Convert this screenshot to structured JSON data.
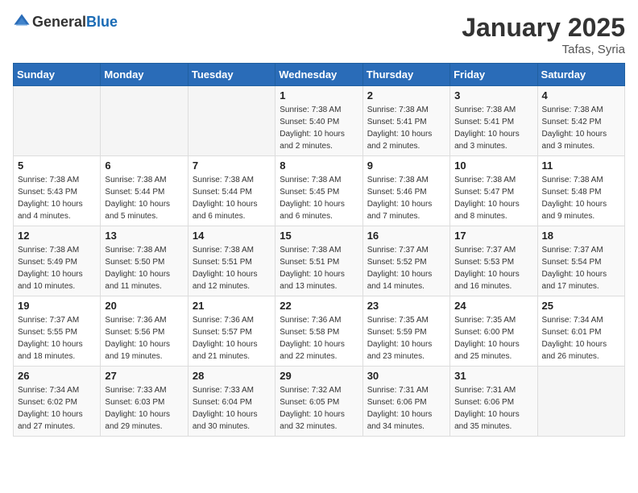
{
  "logo": {
    "general": "General",
    "blue": "Blue"
  },
  "header": {
    "title": "January 2025",
    "subtitle": "Tafas, Syria"
  },
  "weekdays": [
    "Sunday",
    "Monday",
    "Tuesday",
    "Wednesday",
    "Thursday",
    "Friday",
    "Saturday"
  ],
  "weeks": [
    [
      {
        "day": "",
        "sunrise": "",
        "sunset": "",
        "daylight": ""
      },
      {
        "day": "",
        "sunrise": "",
        "sunset": "",
        "daylight": ""
      },
      {
        "day": "",
        "sunrise": "",
        "sunset": "",
        "daylight": ""
      },
      {
        "day": "1",
        "sunrise": "Sunrise: 7:38 AM",
        "sunset": "Sunset: 5:40 PM",
        "daylight": "Daylight: 10 hours and 2 minutes."
      },
      {
        "day": "2",
        "sunrise": "Sunrise: 7:38 AM",
        "sunset": "Sunset: 5:41 PM",
        "daylight": "Daylight: 10 hours and 2 minutes."
      },
      {
        "day": "3",
        "sunrise": "Sunrise: 7:38 AM",
        "sunset": "Sunset: 5:41 PM",
        "daylight": "Daylight: 10 hours and 3 minutes."
      },
      {
        "day": "4",
        "sunrise": "Sunrise: 7:38 AM",
        "sunset": "Sunset: 5:42 PM",
        "daylight": "Daylight: 10 hours and 3 minutes."
      }
    ],
    [
      {
        "day": "5",
        "sunrise": "Sunrise: 7:38 AM",
        "sunset": "Sunset: 5:43 PM",
        "daylight": "Daylight: 10 hours and 4 minutes."
      },
      {
        "day": "6",
        "sunrise": "Sunrise: 7:38 AM",
        "sunset": "Sunset: 5:44 PM",
        "daylight": "Daylight: 10 hours and 5 minutes."
      },
      {
        "day": "7",
        "sunrise": "Sunrise: 7:38 AM",
        "sunset": "Sunset: 5:44 PM",
        "daylight": "Daylight: 10 hours and 6 minutes."
      },
      {
        "day": "8",
        "sunrise": "Sunrise: 7:38 AM",
        "sunset": "Sunset: 5:45 PM",
        "daylight": "Daylight: 10 hours and 6 minutes."
      },
      {
        "day": "9",
        "sunrise": "Sunrise: 7:38 AM",
        "sunset": "Sunset: 5:46 PM",
        "daylight": "Daylight: 10 hours and 7 minutes."
      },
      {
        "day": "10",
        "sunrise": "Sunrise: 7:38 AM",
        "sunset": "Sunset: 5:47 PM",
        "daylight": "Daylight: 10 hours and 8 minutes."
      },
      {
        "day": "11",
        "sunrise": "Sunrise: 7:38 AM",
        "sunset": "Sunset: 5:48 PM",
        "daylight": "Daylight: 10 hours and 9 minutes."
      }
    ],
    [
      {
        "day": "12",
        "sunrise": "Sunrise: 7:38 AM",
        "sunset": "Sunset: 5:49 PM",
        "daylight": "Daylight: 10 hours and 10 minutes."
      },
      {
        "day": "13",
        "sunrise": "Sunrise: 7:38 AM",
        "sunset": "Sunset: 5:50 PM",
        "daylight": "Daylight: 10 hours and 11 minutes."
      },
      {
        "day": "14",
        "sunrise": "Sunrise: 7:38 AM",
        "sunset": "Sunset: 5:51 PM",
        "daylight": "Daylight: 10 hours and 12 minutes."
      },
      {
        "day": "15",
        "sunrise": "Sunrise: 7:38 AM",
        "sunset": "Sunset: 5:51 PM",
        "daylight": "Daylight: 10 hours and 13 minutes."
      },
      {
        "day": "16",
        "sunrise": "Sunrise: 7:37 AM",
        "sunset": "Sunset: 5:52 PM",
        "daylight": "Daylight: 10 hours and 14 minutes."
      },
      {
        "day": "17",
        "sunrise": "Sunrise: 7:37 AM",
        "sunset": "Sunset: 5:53 PM",
        "daylight": "Daylight: 10 hours and 16 minutes."
      },
      {
        "day": "18",
        "sunrise": "Sunrise: 7:37 AM",
        "sunset": "Sunset: 5:54 PM",
        "daylight": "Daylight: 10 hours and 17 minutes."
      }
    ],
    [
      {
        "day": "19",
        "sunrise": "Sunrise: 7:37 AM",
        "sunset": "Sunset: 5:55 PM",
        "daylight": "Daylight: 10 hours and 18 minutes."
      },
      {
        "day": "20",
        "sunrise": "Sunrise: 7:36 AM",
        "sunset": "Sunset: 5:56 PM",
        "daylight": "Daylight: 10 hours and 19 minutes."
      },
      {
        "day": "21",
        "sunrise": "Sunrise: 7:36 AM",
        "sunset": "Sunset: 5:57 PM",
        "daylight": "Daylight: 10 hours and 21 minutes."
      },
      {
        "day": "22",
        "sunrise": "Sunrise: 7:36 AM",
        "sunset": "Sunset: 5:58 PM",
        "daylight": "Daylight: 10 hours and 22 minutes."
      },
      {
        "day": "23",
        "sunrise": "Sunrise: 7:35 AM",
        "sunset": "Sunset: 5:59 PM",
        "daylight": "Daylight: 10 hours and 23 minutes."
      },
      {
        "day": "24",
        "sunrise": "Sunrise: 7:35 AM",
        "sunset": "Sunset: 6:00 PM",
        "daylight": "Daylight: 10 hours and 25 minutes."
      },
      {
        "day": "25",
        "sunrise": "Sunrise: 7:34 AM",
        "sunset": "Sunset: 6:01 PM",
        "daylight": "Daylight: 10 hours and 26 minutes."
      }
    ],
    [
      {
        "day": "26",
        "sunrise": "Sunrise: 7:34 AM",
        "sunset": "Sunset: 6:02 PM",
        "daylight": "Daylight: 10 hours and 27 minutes."
      },
      {
        "day": "27",
        "sunrise": "Sunrise: 7:33 AM",
        "sunset": "Sunset: 6:03 PM",
        "daylight": "Daylight: 10 hours and 29 minutes."
      },
      {
        "day": "28",
        "sunrise": "Sunrise: 7:33 AM",
        "sunset": "Sunset: 6:04 PM",
        "daylight": "Daylight: 10 hours and 30 minutes."
      },
      {
        "day": "29",
        "sunrise": "Sunrise: 7:32 AM",
        "sunset": "Sunset: 6:05 PM",
        "daylight": "Daylight: 10 hours and 32 minutes."
      },
      {
        "day": "30",
        "sunrise": "Sunrise: 7:31 AM",
        "sunset": "Sunset: 6:06 PM",
        "daylight": "Daylight: 10 hours and 34 minutes."
      },
      {
        "day": "31",
        "sunrise": "Sunrise: 7:31 AM",
        "sunset": "Sunset: 6:06 PM",
        "daylight": "Daylight: 10 hours and 35 minutes."
      },
      {
        "day": "",
        "sunrise": "",
        "sunset": "",
        "daylight": ""
      }
    ]
  ]
}
